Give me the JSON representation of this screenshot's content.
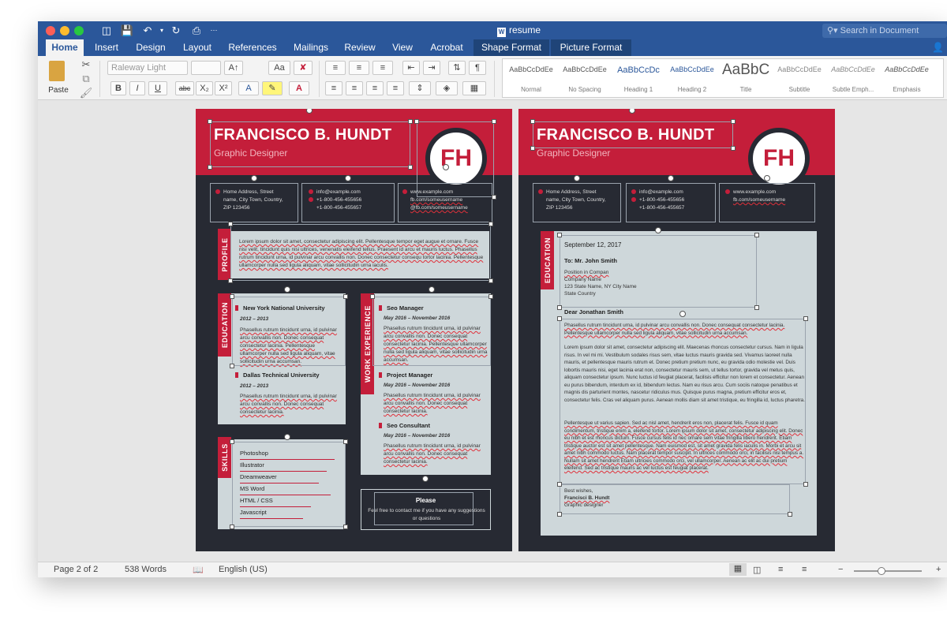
{
  "window": {
    "title": "resume",
    "search_placeholder": "Search in Document"
  },
  "ribbon_tabs": [
    "Home",
    "Insert",
    "Design",
    "Layout",
    "References",
    "Mailings",
    "Review",
    "View",
    "Acrobat",
    "Shape Format",
    "Picture Format"
  ],
  "ribbon": {
    "paste_label": "Paste",
    "font_name": "Raleway Light",
    "font_size": "",
    "styles": [
      {
        "preview": "AaBbCcDdEe",
        "label": "Normal"
      },
      {
        "preview": "AaBbCcDdEe",
        "label": "No Spacing"
      },
      {
        "preview": "AaBbCcDc",
        "label": "Heading 1"
      },
      {
        "preview": "AaBbCcDdEe",
        "label": "Heading 2"
      },
      {
        "preview": "AaBbC",
        "label": "Title"
      },
      {
        "preview": "AaBbCcDdEe",
        "label": "Subtitle"
      },
      {
        "preview": "AaBbCcDdEe",
        "label": "Subtle Emph..."
      },
      {
        "preview": "AaBbCcDdEe",
        "label": "Emphasis"
      }
    ]
  },
  "resume": {
    "name": "FRANCISCO B. HUNDT",
    "title": "Graphic Designer",
    "monogram": "FH",
    "address": [
      "Home Address, Street",
      "name, City Town, Country,",
      "ZIP 123456"
    ],
    "email": "info@example.com",
    "phones": [
      "+1-800-456-455656",
      "+1-800-456-455657"
    ],
    "web": [
      "www.example.com",
      "fb.com/someusername",
      "@fb.com/someusername"
    ],
    "profile_tab": "PROFILE",
    "profile_text": "Lorem ipsum dolor sit amet, consectetur adipiscing elit. Pellentesque tempor eget augue et ornare. Fusce nisi velit, tincidunt quis nisi ultrices, venenatis eleifend tellus. Praesent id arcu et mauris luctus. Phasellus rutrum tincidunt urna, id pulvinar arcu convallis non. Donec consectetur consequ tortor lacinia. Pellentesque ullamcorper nulla sed ligula aliquam, vitae sollicitudin urna iaculis.",
    "education_tab": "EDUCATION",
    "education": [
      {
        "school": "New York National University",
        "dates": "2012 – 2013",
        "text": "Phasellus rutrum tincidunt urna, id pulvinar arcu convallis non. Donec consequat consectetur lacinia. Pellentesque ullamcorper nulla sed ligula aliquam, vitae sollicitudin urna accumsan."
      },
      {
        "school": "Dallas Technical University",
        "dates": "2012 – 2013",
        "text": "Phasellus rutrum tincidunt urna, id pulvinar arcu convallis non. Donec consequat consectetur lacinia."
      }
    ],
    "work_tab": "WORK EXPERIENCE",
    "work": [
      {
        "role": "Seo Manager",
        "dates": "May 2016 – November 2016",
        "text": "Phasellus rutrum tincidunt urna, id pulvinar arcu convallis non. Donec consequat consectetur lacinia. Pellentesque ullamcorper nulla sed ligula aliquam, vitae sollicitudin urna accumsan."
      },
      {
        "role": "Project Manager",
        "dates": "May 2016 – November 2016",
        "text": "Phasellus rutrum tincidunt urna, id pulvinar arcu convallis non. Donec consequat consectetur lacinia."
      },
      {
        "role": "Seo Consultant",
        "dates": "May 2016 – November 2016",
        "text": "Phasellus rutrum tincidunt urna, id pulvinar arcu convallis non. Donec consequat consectetur lacinia."
      }
    ],
    "skills_tab": "SKILLS",
    "skills": [
      "Photoshop",
      "Illustrator",
      "Dreamweaver",
      "MS Word",
      "HTML / CSS",
      "Javascript"
    ],
    "please_title": "Please",
    "please_text": "Feel free to contact me if you have any suggestions or questions"
  },
  "letter": {
    "date": "September 12, 2017",
    "to": "To: Mr. John Smith",
    "recipient_lines": [
      "Position in Compan",
      "Company Name",
      "123 State Name, NY City Name",
      "State Country"
    ],
    "greeting": "Dear Jonathan Smith",
    "paragraphs": [
      "Phasellus rutrum tincidunt urna, id pulvinar arcu convallis non. Donec consequat consectetur lacinia. Pellentesque ullamcorper nulla sed ligula aliquam, vitae sollicitudin urna accumsan.",
      "Lorem ipsum dolor sit amet, consectetur adipiscing elit. Maecenas rhoncus consectetur cursus. Nam in ligula risus. In vel mi mi. Vestibulum sodales risus sem, vitae luctus mauris gravida sed. Vivamus laoreet nulla mauris, et pellentesque mauris rutrum et. Donec pretium pretium nunc, eu gravida odio molestie vel. Duis lobortis mauris nisi, eget lacinia erat non, consectetur mauris sem, ut tellus tortor, gravida vel metus quis, aliquam consectetur ipsum. Nunc luctus id feugiat placerat, facilisis efficitur non lorem et consectetur. Aenean eu purus bibendum, interdum ex id, bibendum lectus. Nam eu risus arcu. Cum sociis natoque penatibus et magnis dis parturient montes, nascetur ridiculus mus. Quisque purus magna, pretium efficitur eros et, consectetur felis. Cras vel aliquam purus. Aenean mollis diam sit amet tristique, eu fringilla id, luctus pharetra.",
      "Pellentesque ut varius sapien. Sed ac nisl amet, hendrerit eros non, placerat felis. Fusce id quam condimentum, tristique enim a, eleifend tortor. Lorem ipsum dolor sit amet, consectetur adipiscing elit. Donec eu nibh et est rhoncus dictum. Fusce cursus felis id nec ornare sem vitae fringilla libero hendrerit. Etiam tristique auctor est sit amet pellentesque. Nam euismod est, sit amet gravida felis iaculis in. Morbi et arcu sit amet nibh commodo luctus. Nam placerat tempor suscipit. In ultrices commodo orci, in facilisis nisi tempus a. Nullam sit amet hendrerit Etiam ultricies commodo orci, vel ullamcorper. Aenean ac elit ac dui pretium eleifend. Sed ac tristique mauris ac vel luctus est feugiat placerat."
    ],
    "closing": "Best wishes,",
    "signature": "Francisci B. Hundt",
    "sig_title": "Graphic designer",
    "tab": "EDUCATION"
  },
  "status": {
    "page": "Page 2 of 2",
    "words": "538 Words",
    "language": "English (US)"
  },
  "colors": {
    "word_blue": "#2b579a",
    "accent_red": "#c41e3a",
    "page_dark": "#272a33",
    "panel_gray": "#ced7da"
  }
}
